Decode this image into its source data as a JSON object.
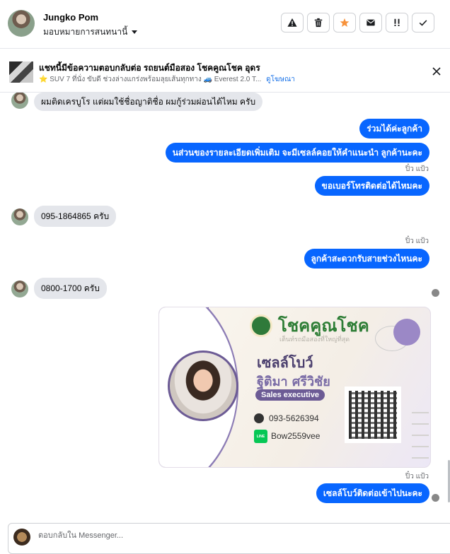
{
  "header": {
    "contact_name": "Jungko Pom",
    "assign_label": "มอบหมายการสนทนานี้",
    "actions": [
      {
        "name": "spam-button",
        "icon": "warning-triangle-icon"
      },
      {
        "name": "delete-button",
        "icon": "trash-icon"
      },
      {
        "name": "star-button",
        "icon": "star-icon"
      },
      {
        "name": "mark-unread-button",
        "icon": "envelope-icon"
      },
      {
        "name": "follow-up-button",
        "icon": "exclamation-icon"
      },
      {
        "name": "done-button",
        "icon": "checkmark-icon"
      }
    ],
    "star_color": "#f7923a"
  },
  "ad": {
    "title": "แชทนี้มีข้อความตอบกลับต่อ รถยนต์มือสอง โชคคูณโชค อุดร",
    "subtitle": "⭐ SUV 7 ที่นั่ง ขับดี ช่วงล่างแกร่งพร้อมลุยเส้นทุกทาง 🚙 Everest 2.0 T...",
    "link": "ดูโฆษณา"
  },
  "messages": [
    {
      "dir": "in",
      "text": "ผมติดเครบูโร แต่ผมใช้ชื่อญาติชื่อ ผมกู้ร่วมผ่อนได้ไหม ครับ"
    },
    {
      "dir": "out",
      "text": "ร่วมได้ค่ะลูกค้า"
    },
    {
      "dir": "out",
      "text": "นส่วนของรายละเอียดเพิ่มเติม จะมีเซลล์คอยให้คำแนะนำ ลูกค้านะคะ"
    },
    {
      "dir": "seen",
      "text": "ปิ๋ว แป้ว"
    },
    {
      "dir": "out",
      "text": "ขอเบอร์โทรติดต่อได้ไหมคะ"
    },
    {
      "dir": "in",
      "text": "095-1864865 ครับ"
    },
    {
      "dir": "seen",
      "text": "ปิ๋ว แป้ว"
    },
    {
      "dir": "out",
      "text": "ลูกค้าสะดวกรับสายช่วงไหนคะ"
    },
    {
      "dir": "in",
      "text": "0800-1700 ครับ"
    },
    {
      "dir": "seen",
      "text": "ปิ๋ว แป้ว"
    },
    {
      "dir": "out",
      "text": "เซลล์โบว์ติดต่อเข้าไปนะคะ"
    }
  ],
  "card": {
    "brand": "โชคคูณโชค",
    "tagline": "เต็นท์รถมือสองที่ใหญ่ที่สุด",
    "nickname": "เซลล์โบว์",
    "fullname": "ฐิติมา ศรีวิชัย",
    "role": "Sales executive",
    "phone": "093-5626394",
    "line_badge": "LINE",
    "line_id": "Bow2559vee",
    "accent": "#6c5b95"
  },
  "composer": {
    "placeholder": "ตอบกลับใน Messenger..."
  },
  "colors": {
    "outgoing_bubble": "#0866ff",
    "incoming_bubble": "#e4e6eb"
  }
}
